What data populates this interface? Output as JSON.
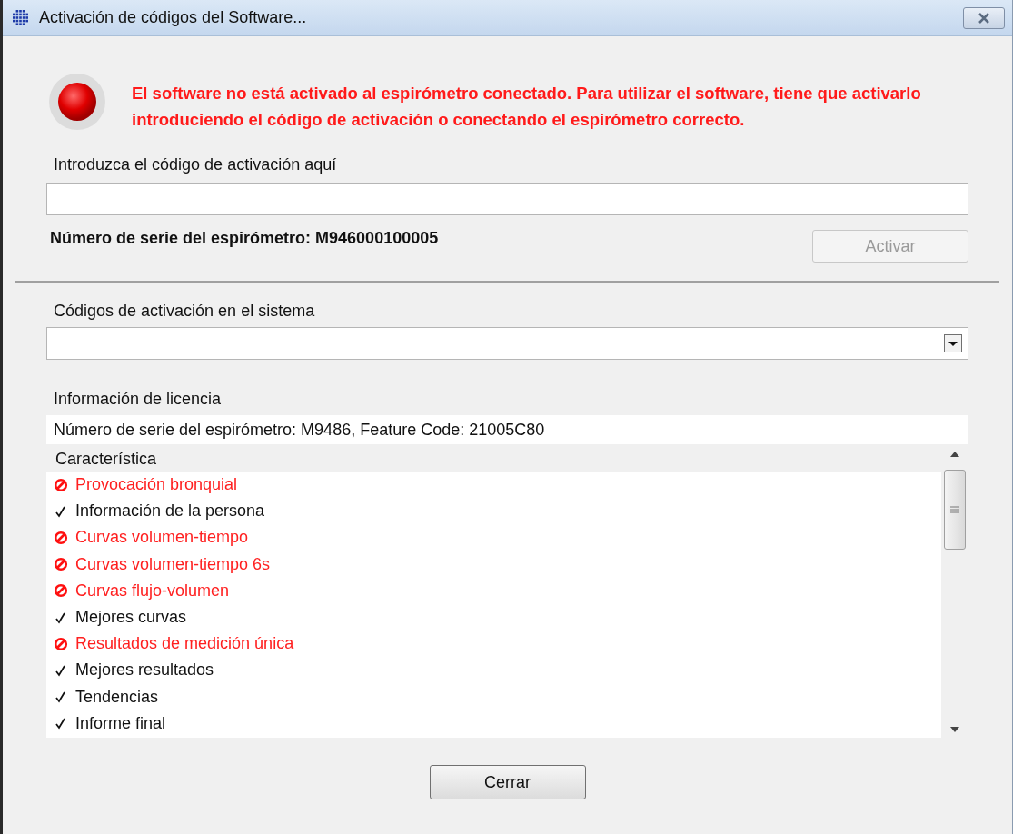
{
  "window": {
    "title": "Activación de códigos del Software..."
  },
  "warning": {
    "text": "El software no está activado al espirómetro conectado. Para utilizar el software, tiene que activarlo introduciendo el código de activación o conectando el espirómetro correcto."
  },
  "code_field": {
    "label": "Introduzca el código de activación aquí"
  },
  "serial": "Número de serie del espirómetro: M946000100005",
  "activate_button": {
    "label": "Activar",
    "disabled": true
  },
  "codes_dropdown": {
    "label": "Códigos de activación en el sistema"
  },
  "license": {
    "label": "Información de licencia",
    "info": "Número de serie del espirómetro: M9486, Feature Code: 21005C80",
    "column": "Característica",
    "features": [
      {
        "name": "Provocación bronquial",
        "enabled": false
      },
      {
        "name": "Información de la persona",
        "enabled": true
      },
      {
        "name": "Curvas volumen-tiempo",
        "enabled": false
      },
      {
        "name": "Curvas volumen-tiempo 6s",
        "enabled": false
      },
      {
        "name": "Curvas flujo-volumen",
        "enabled": false
      },
      {
        "name": "Mejores curvas",
        "enabled": true
      },
      {
        "name": "Resultados de medición única",
        "enabled": false
      },
      {
        "name": "Mejores resultados",
        "enabled": true
      },
      {
        "name": "Tendencias",
        "enabled": true
      },
      {
        "name": "Informe final",
        "enabled": true
      }
    ]
  },
  "close_button": {
    "label": "Cerrar"
  }
}
